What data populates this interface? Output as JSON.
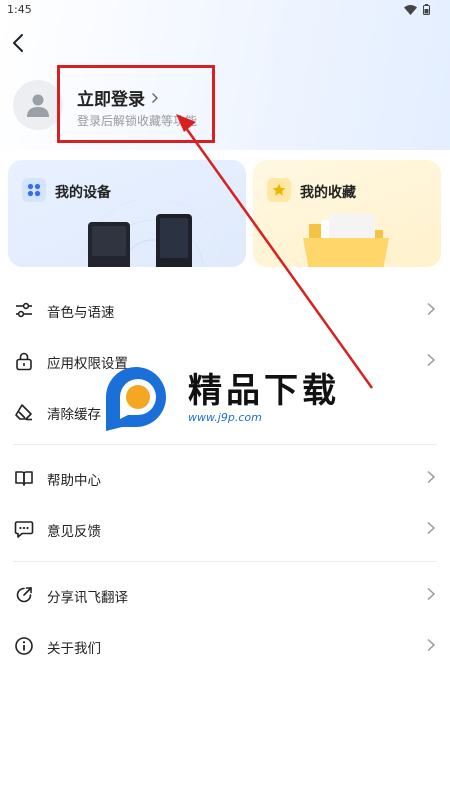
{
  "status_bar": {
    "time": "1:45"
  },
  "login": {
    "title": "立即登录",
    "subtitle": "登录后解锁收藏等功能"
  },
  "cards": [
    {
      "title": "我的设备",
      "icon": "grid-icon",
      "accent": "#2f6ff0"
    },
    {
      "title": "我的收藏",
      "icon": "star-icon",
      "accent": "#f0b500"
    }
  ],
  "menu": [
    {
      "label": "音色与语速",
      "icon": "sliders-icon"
    },
    {
      "label": "应用权限设置",
      "icon": "lock-icon"
    },
    {
      "label": "清除缓存",
      "icon": "eraser-icon"
    },
    {
      "label": "帮助中心",
      "icon": "book-icon"
    },
    {
      "label": "意见反馈",
      "icon": "chat-icon"
    },
    {
      "label": "分享讯飞翻译",
      "icon": "share-icon"
    },
    {
      "label": "关于我们",
      "icon": "info-icon"
    }
  ],
  "watermark": {
    "text": "精品下载",
    "url": "www.j9p.com"
  },
  "colors": {
    "highlight": "#d92020",
    "brand_blue": "#1b6fd8",
    "brand_orange": "#f5a623"
  }
}
